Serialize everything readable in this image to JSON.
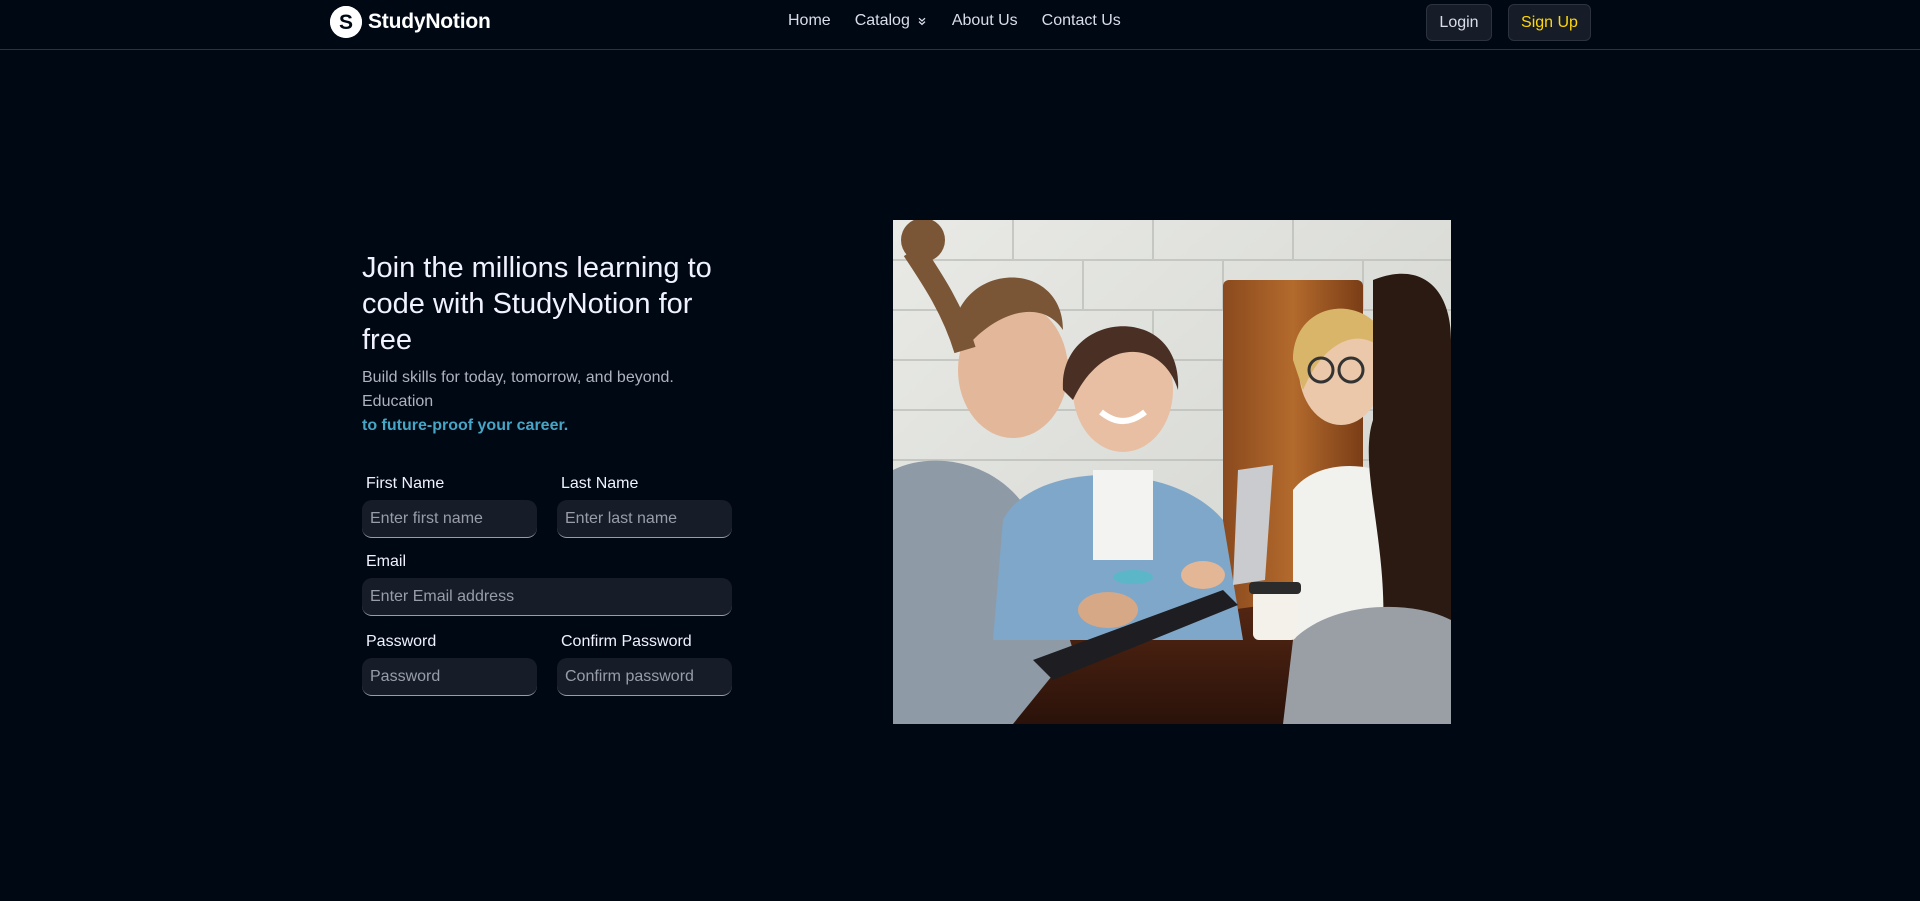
{
  "brand": {
    "logo_letter": "S",
    "name": "StudyNotion"
  },
  "nav": {
    "links": [
      {
        "label": "Home"
      },
      {
        "label": "Catalog"
      },
      {
        "label": "About Us"
      },
      {
        "label": "Contact Us"
      }
    ],
    "login_label": "Login",
    "signup_label": "Sign Up"
  },
  "hero": {
    "heading": "Join the millions learning to code with StudyNotion for free",
    "subtitle": "Build skills for today, tomorrow, and beyond. Education",
    "accent": "to future-proof your career."
  },
  "form": {
    "first_name": {
      "label": "First Name",
      "placeholder": "Enter first name",
      "value": ""
    },
    "last_name": {
      "label": "Last Name",
      "placeholder": "Enter last name",
      "value": ""
    },
    "email": {
      "label": "Email",
      "placeholder": "Enter Email address",
      "value": ""
    },
    "password": {
      "label": "Password",
      "placeholder": "Password",
      "value": ""
    },
    "confirm_password": {
      "label": "Confirm Password",
      "placeholder": "Confirm password",
      "value": ""
    }
  },
  "image": {
    "icon": "group-of-students-photo"
  },
  "colors": {
    "background": "#000814",
    "accent_yellow": "#FFD60A",
    "accent_blue": "#47A5C5",
    "input_bg": "#161D29"
  }
}
